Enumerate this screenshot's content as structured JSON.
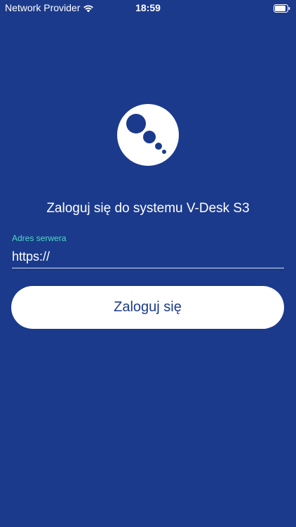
{
  "status_bar": {
    "carrier": "Network Provider",
    "time": "18:59",
    "wifi_icon": "wifi-icon",
    "battery_icon": "battery-icon"
  },
  "logo": {
    "icon": "bubbles-logo"
  },
  "login": {
    "title": "Zaloguj się do systemu V-Desk S3",
    "server_label": "Adres serwera",
    "server_value": "https://",
    "button_label": "Zaloguj się"
  },
  "colors": {
    "background": "#1b3a8c",
    "label_accent": "#4fd8c0",
    "button_background": "#ffffff",
    "button_text": "#1b3a8c"
  }
}
